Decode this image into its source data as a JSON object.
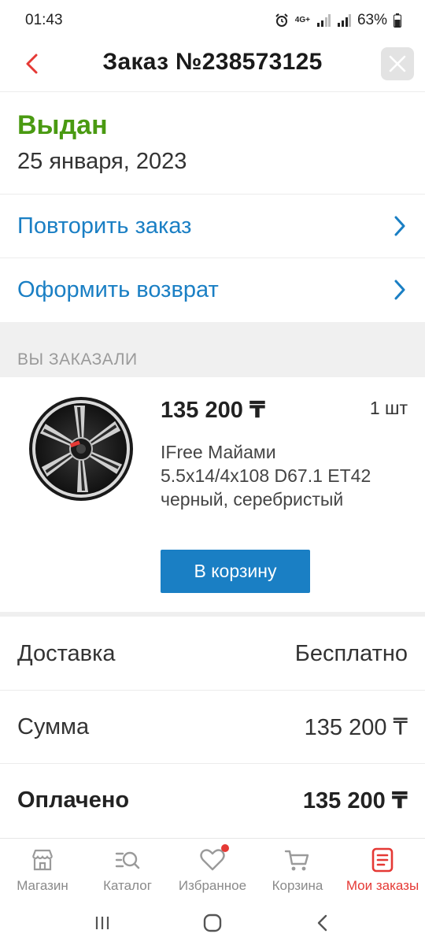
{
  "status_bar": {
    "time": "01:43",
    "network": "4G+",
    "battery": "63%"
  },
  "header": {
    "title": "Заказ №238573125",
    "back_icon": "chevron-left-icon",
    "close_icon": "close-icon"
  },
  "order_status": {
    "status": "Выдан",
    "date": "25 января, 2023",
    "status_color": "#4a9a12"
  },
  "actions": [
    {
      "label": "Повторить заказ"
    },
    {
      "label": "Оформить возврат"
    }
  ],
  "ordered_section": {
    "title": "ВЫ ЗАКАЗАЛИ"
  },
  "product": {
    "price": "135 200 ₸",
    "quantity": "1 шт",
    "name": "IFree Майами 5.5x14/4x108 D67.1 ET42 черный, серебристый",
    "add_to_cart_label": "В корзину"
  },
  "summary": [
    {
      "label": "Доставка",
      "value": "Бесплатно"
    },
    {
      "label": "Сумма",
      "value": "135 200 ₸"
    },
    {
      "label": "Оплачено",
      "value": "135 200 ₸"
    }
  ],
  "bottom_nav": [
    {
      "label": "Магазин",
      "icon": "store-icon"
    },
    {
      "label": "Каталог",
      "icon": "catalog-search-icon"
    },
    {
      "label": "Избранное",
      "icon": "heart-icon"
    },
    {
      "label": "Корзина",
      "icon": "cart-icon"
    },
    {
      "label": "Мои заказы",
      "icon": "orders-icon",
      "active": true
    }
  ],
  "colors": {
    "accent_blue": "#1a7fc4",
    "accent_red": "#e53935",
    "status_green": "#4a9a12"
  }
}
